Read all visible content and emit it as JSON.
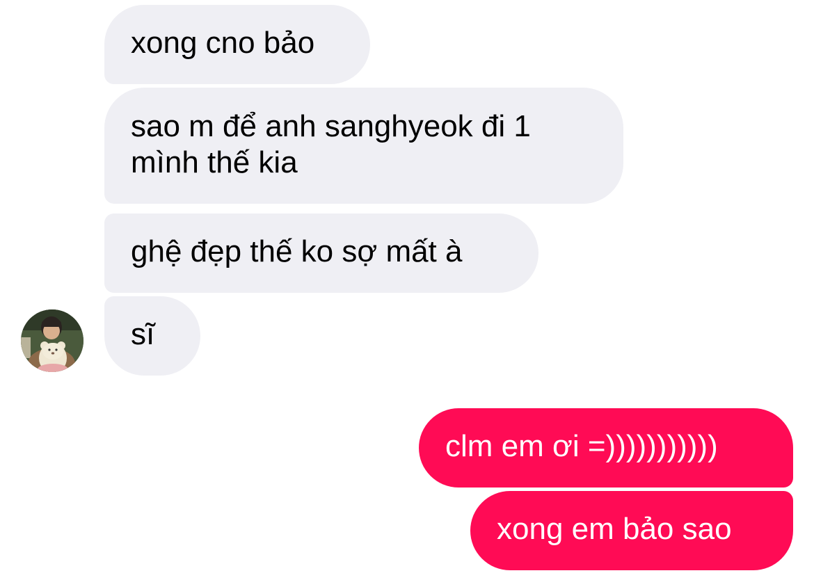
{
  "messages": [
    {
      "id": "b1",
      "direction": "incoming",
      "text": "xong cno bảo"
    },
    {
      "id": "b2",
      "direction": "incoming",
      "line1": "sao m để anh sanghyeok đi 1",
      "line2": "mình thế kia"
    },
    {
      "id": "b3",
      "direction": "incoming",
      "text": "ghệ đẹp thế ko sợ mất à"
    },
    {
      "id": "b4",
      "direction": "incoming",
      "text": "sĩ"
    },
    {
      "id": "b5",
      "direction": "outgoing",
      "text": "clm em ơi =)))))))))))"
    },
    {
      "id": "b6",
      "direction": "outgoing",
      "text": "xong em bảo sao"
    }
  ],
  "avatar": {
    "icon": "contact-avatar"
  },
  "colors": {
    "incoming_bubble": "#EFEFF4",
    "outgoing_bubble": "#FF0B55",
    "incoming_text": "#000000",
    "outgoing_text": "#FFFFFF"
  }
}
